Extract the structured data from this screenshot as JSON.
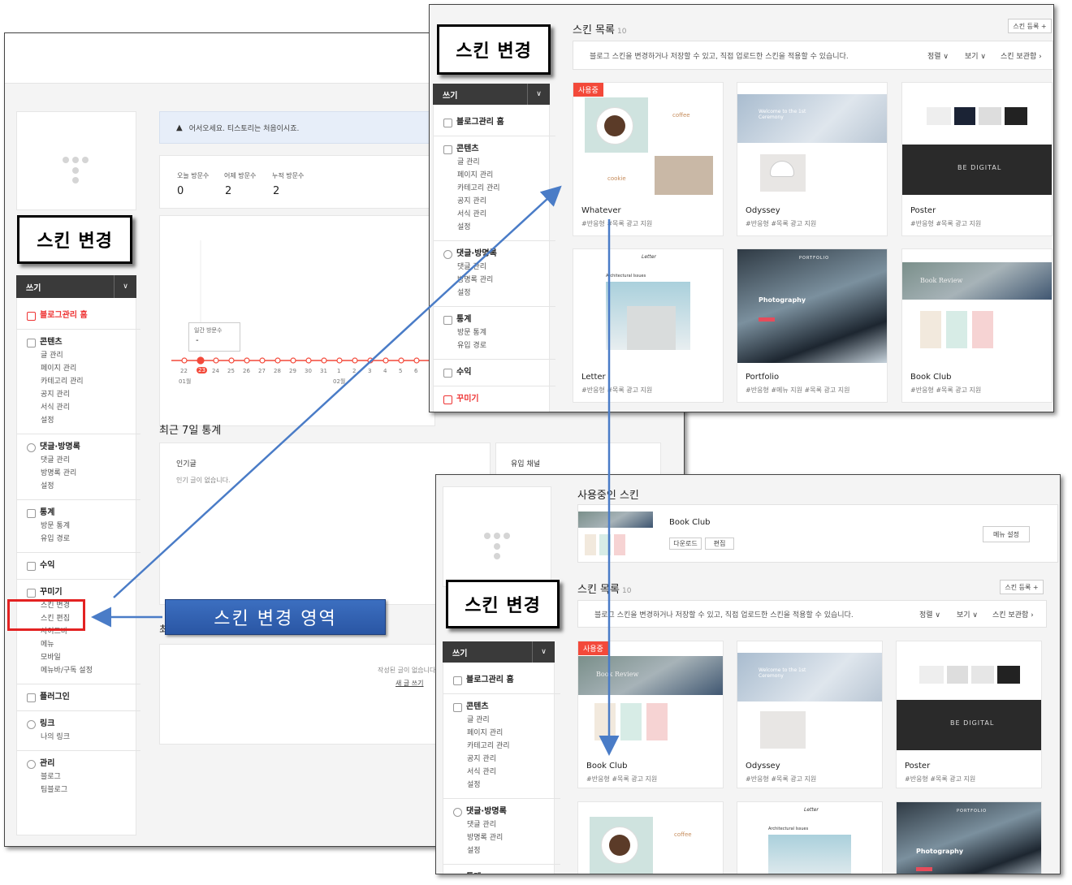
{
  "callouts": {
    "left": "스킨 변경",
    "top": "스킨 변경",
    "bottom": "스킨 변경",
    "region": "스킨 변경 영역"
  },
  "write_label": "쓰기",
  "chevron": "∨",
  "main_screen": {
    "notice": "어서오세요. 티스토리는 처음이시죠.",
    "stats": [
      {
        "label": "오늘 방문수",
        "value": "0"
      },
      {
        "label": "어제 방문수",
        "value": "2"
      },
      {
        "label": "누적 방문수",
        "value": "2"
      }
    ],
    "chart_tooltip": {
      "label": "일간 방문수",
      "value": "-"
    },
    "chart_x": [
      "22",
      "23",
      "24",
      "25",
      "26",
      "27",
      "28",
      "29",
      "30",
      "31",
      "1",
      "2",
      "3",
      "4",
      "5",
      "6"
    ],
    "chart_month_left": "01월",
    "chart_month_right": "02월",
    "section_title": "최근 7일 통계",
    "popular_title": "인기글",
    "popular_empty": "인기 글이 없습니다.",
    "inflow_title": "유입 채널",
    "recent_prefix": "최",
    "no_posts": "작성된 글이 없습니다",
    "new_post": "새 글 쓰기"
  },
  "sidebar_full": {
    "home": "블로그관리 홈",
    "groups": [
      {
        "title": "콘텐츠",
        "items": [
          "글 관리",
          "페이지 관리",
          "카테고리 관리",
          "공지 관리",
          "서식 관리",
          "설정"
        ]
      },
      {
        "title": "댓글·방명록",
        "items": [
          "댓글 관리",
          "방명록 관리",
          "설정"
        ]
      },
      {
        "title": "통계",
        "items": [
          "방문 통계",
          "유입 경로"
        ]
      },
      {
        "title": "수익",
        "items": []
      },
      {
        "title": "꾸미기",
        "items": [
          "스킨 변경",
          "스킨 편집",
          "사이드바",
          "메뉴",
          "모바일",
          "메뉴바/구독 설정"
        ]
      },
      {
        "title": "플러그인",
        "items": []
      },
      {
        "title": "링크",
        "items": [
          "나의 링크"
        ]
      },
      {
        "title": "관리",
        "items": [
          "블로그",
          "팀블로그"
        ]
      }
    ]
  },
  "skin_list": {
    "title": "스킨 목록",
    "count": "10",
    "register": "스킨 등록 +",
    "desc": "블로그 스킨을 변경하거나 저장할 수 있고, 직접 업로드한 스킨을 적용할 수 있습니다.",
    "sort": "정렬 ∨",
    "view": "보기 ∨",
    "storage": "스킨 보관함 ›",
    "in_use": "사용중",
    "tags_basic": "#반응형  #목록 광고 지원",
    "tags_portfolio": "#반응형  #메뉴 지원  #목록 광고 지원"
  },
  "top_cards": [
    {
      "name": "Whatever",
      "tags": "#반응형  #목록 광고 지원"
    },
    {
      "name": "Odyssey",
      "tags": "#반응형  #목록 광고 지원"
    },
    {
      "name": "Poster",
      "tags": "#반응형  #목록 광고 지원"
    },
    {
      "name": "Letter",
      "tags": "#반응형  #목록 광고 지원"
    },
    {
      "name": "Portfolio",
      "tags": "#반응형  #메뉴 지원  #목록 광고 지원"
    },
    {
      "name": "Book Club",
      "tags": "#반응형  #목록 광고 지원"
    }
  ],
  "bottom_cards": [
    {
      "name": "Book Club",
      "tags": "#반응형  #목록 광고 지원"
    },
    {
      "name": "Odyssey",
      "tags": "#반응형  #목록 광고 지원"
    },
    {
      "name": "Poster",
      "tags": "#반응형  #목록 광고 지원"
    }
  ],
  "current_skin": {
    "title": "사용중인 스킨",
    "name": "Book Club",
    "download": "다운로드",
    "edit": "편집",
    "menu_setting": "메뉴 설정"
  },
  "thumb_text": {
    "coffee": "coffee",
    "cookie": "cookie",
    "welcome": "Welcome to the 1st Ceremony",
    "be_digital": "BE DIGITAL",
    "letter": "Letter",
    "arch": "Architectural Issues",
    "portfolio": "PORTFOLIO",
    "photography": "Photography",
    "book_review": "Book Review",
    "odyssey_brand": "Odyssey"
  },
  "colors": {
    "accent": "#f3493a",
    "callout_blue": "#2a56a4",
    "arrow": "#4a7cc7",
    "highlight": "#e32222"
  }
}
